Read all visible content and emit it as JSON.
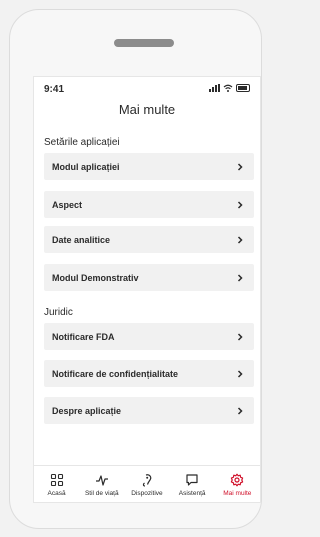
{
  "status_bar": {
    "time": "9:41"
  },
  "header": {
    "title": "Mai multe"
  },
  "sections": {
    "app_settings": {
      "title": "Setările aplicației",
      "items": [
        {
          "label": "Modul aplicației"
        },
        {
          "label": "Aspect"
        },
        {
          "label": "Date analitice"
        },
        {
          "label": "Modul Demonstrativ"
        }
      ]
    },
    "legal": {
      "title": "Juridic",
      "items": [
        {
          "label": "Notificare FDA"
        },
        {
          "label": "Notificare de confidențialitate"
        },
        {
          "label": "Despre aplicație"
        }
      ]
    }
  },
  "tabs": [
    {
      "label": "Acasă",
      "icon": "grid-icon"
    },
    {
      "label": "Stil de viață",
      "icon": "pulse-icon"
    },
    {
      "label": "Dispozitive",
      "icon": "hearing-aid-icon"
    },
    {
      "label": "Asistență",
      "icon": "chat-icon"
    },
    {
      "label": "Mai multe",
      "icon": "gear-icon",
      "active": true
    }
  ],
  "colors": {
    "accent": "#d0102a",
    "row_bg": "#f1f1f1",
    "text": "#2b2b2b"
  }
}
